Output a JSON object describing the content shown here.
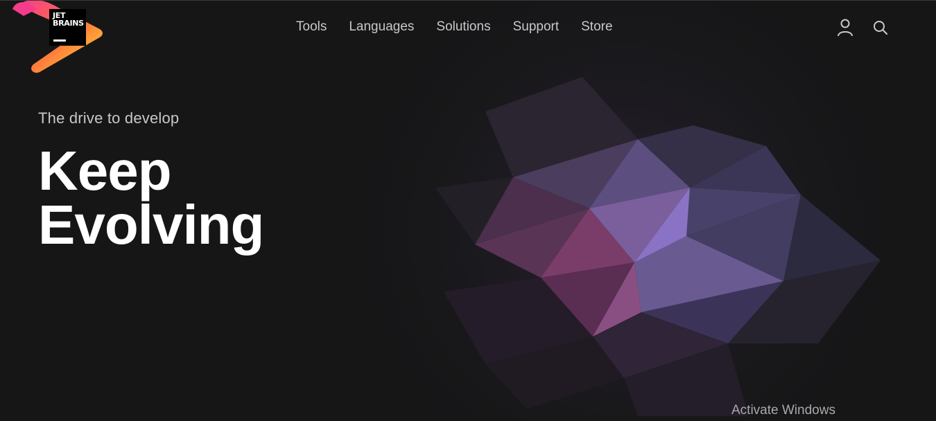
{
  "brand": {
    "logo_text": "JET\nBRAINS",
    "gradient_colors": [
      "#f53b8b",
      "#ff7a3b",
      "#fde133"
    ]
  },
  "nav": {
    "items": [
      "Tools",
      "Languages",
      "Solutions",
      "Support",
      "Store"
    ]
  },
  "header_icons": [
    "user-icon",
    "search-icon"
  ],
  "hero": {
    "eyebrow": "The drive to develop",
    "headline_line1": "Keep",
    "headline_line2": "Evolving"
  },
  "os_overlay": {
    "watermark": "Activate Windows"
  },
  "colors": {
    "background": "#161617",
    "nav_text": "#c9c9cc",
    "headline": "#ffffff",
    "accent_purple": "#8a6fc8",
    "accent_magenta": "#9b4a82"
  }
}
